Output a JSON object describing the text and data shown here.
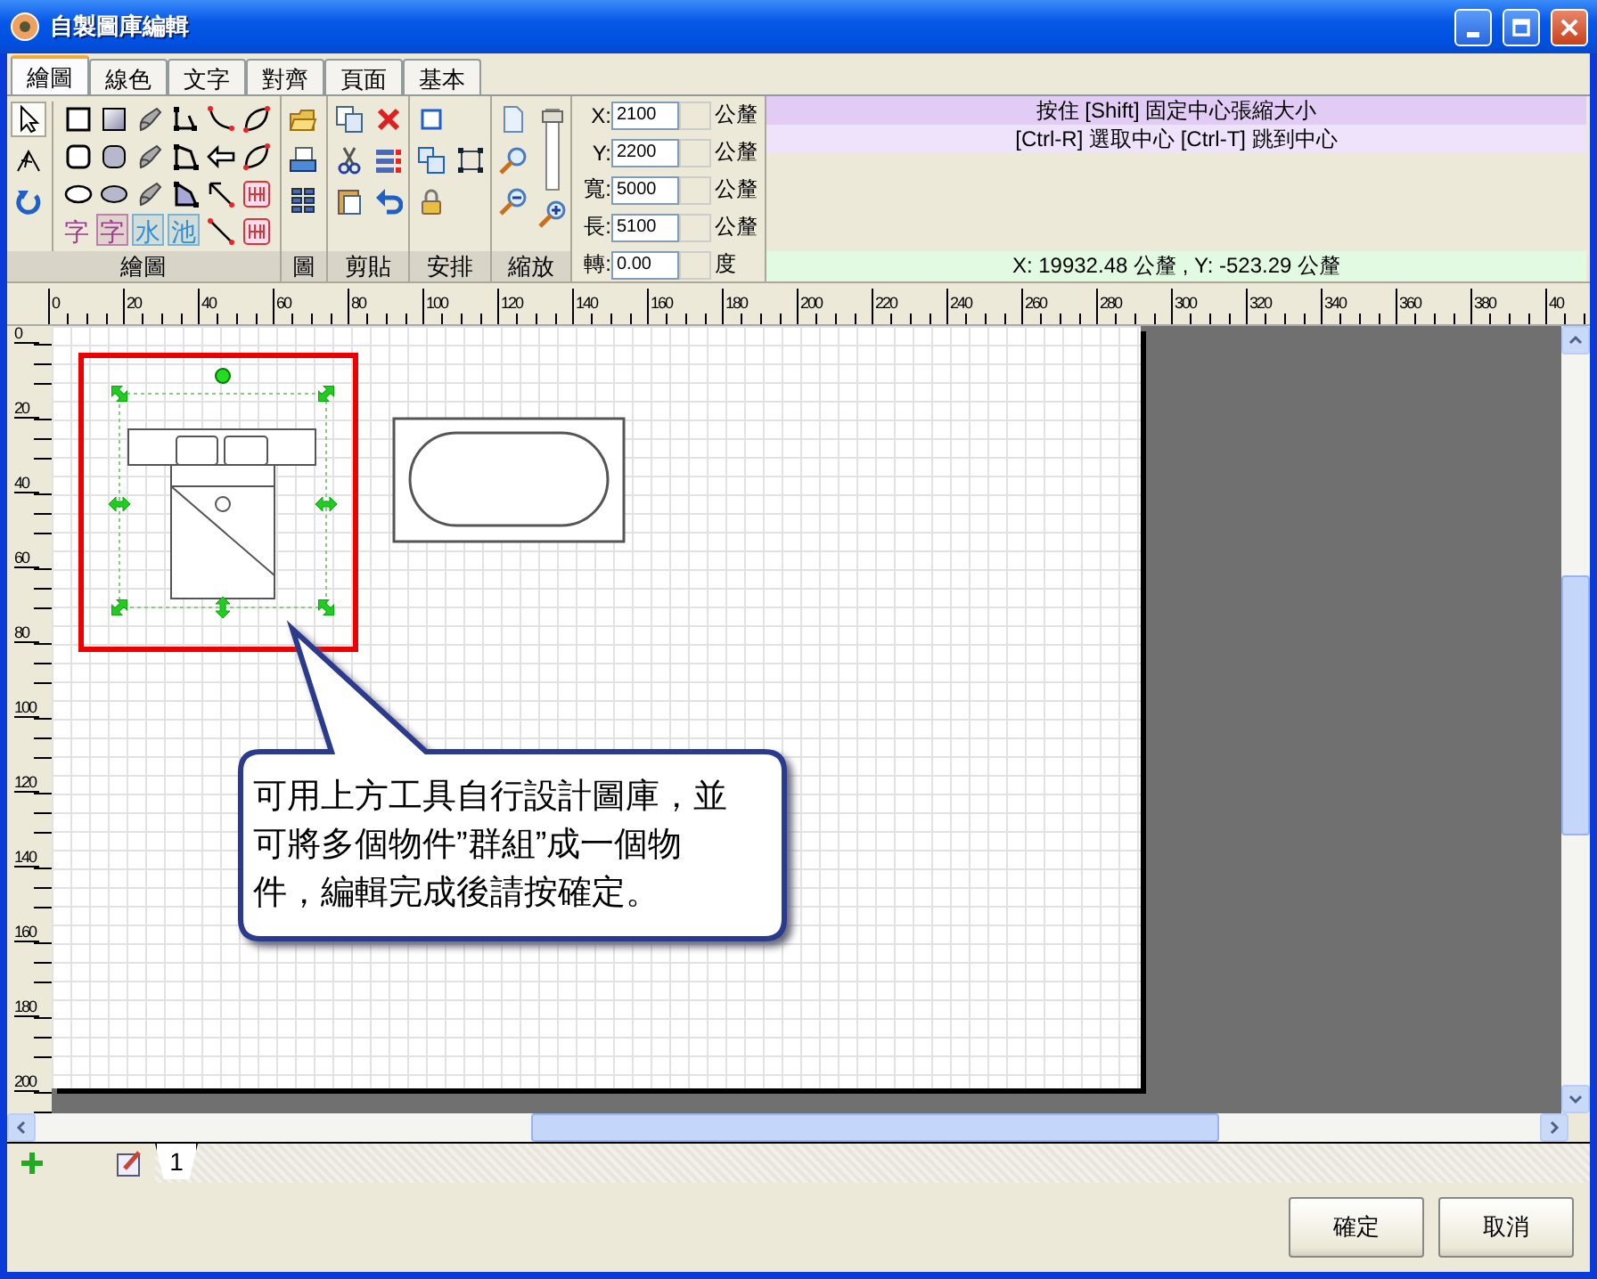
{
  "window": {
    "title": "自製圖庫編輯"
  },
  "tabs": [
    {
      "label": "繪圖",
      "selected": true
    },
    {
      "label": "線色",
      "selected": false
    },
    {
      "label": "文字",
      "selected": false
    },
    {
      "label": "對齊",
      "selected": false
    },
    {
      "label": "頁面",
      "selected": false
    },
    {
      "label": "基本",
      "selected": false
    }
  ],
  "toolbar": {
    "groups": [
      {
        "label": "繪圖"
      },
      {
        "label": "圖"
      },
      {
        "label": "剪貼"
      },
      {
        "label": "安排"
      },
      {
        "label": "縮放"
      }
    ],
    "draw_tools": [
      {
        "selected": true
      },
      {
        "selected": false
      },
      {
        "selected": false
      }
    ],
    "glyph_tools": [
      {
        "text": "字",
        "color": "#9c3a8c",
        "filled": false
      },
      {
        "text": "字",
        "color": "#9c3a8c",
        "filled": true
      },
      {
        "text": "水",
        "color": "#2f8fd8",
        "filled": true
      },
      {
        "text": "池",
        "color": "#2f8fd8",
        "filled": true
      }
    ],
    "zoom_slider": {
      "level": 1
    },
    "fields": [
      {
        "label": "X:",
        "value": "2100",
        "unit": "公釐"
      },
      {
        "label": "Y:",
        "value": "2200",
        "unit": "公釐"
      },
      {
        "label": "寬:",
        "value": "5000",
        "unit": "公釐"
      },
      {
        "label": "長:",
        "value": "5100",
        "unit": "公釐"
      },
      {
        "label": "轉:",
        "value": "0.00",
        "unit": "度"
      }
    ],
    "hints": [
      "按住 [Shift] 固定中心張縮大小",
      "[Ctrl-R] 選取中心 [Ctrl-T] 跳到中心"
    ],
    "cursor_position": "X: 19932.48 公釐 , Y: -523.29 公釐"
  },
  "rulers": {
    "horizontal": [
      "0",
      "20",
      "40",
      "60",
      "80",
      "100",
      "120",
      "140",
      "160",
      "180",
      "200",
      "220",
      "240",
      "260",
      "280",
      "300",
      "320",
      "340",
      "360",
      "380",
      "40"
    ],
    "vertical": [
      "0",
      "20",
      "40",
      "60",
      "80",
      "100",
      "120",
      "140",
      "160",
      "180",
      "200"
    ]
  },
  "canvas": {
    "callout": {
      "text": "可用上方工具自行設計圖庫，並可將多個物件”群組”成一個物件，編輯完成後請按確定。"
    }
  },
  "sheet_tabs": [
    {
      "label": "1",
      "selected": true
    }
  ],
  "buttons": [
    "確定",
    "取消"
  ]
}
